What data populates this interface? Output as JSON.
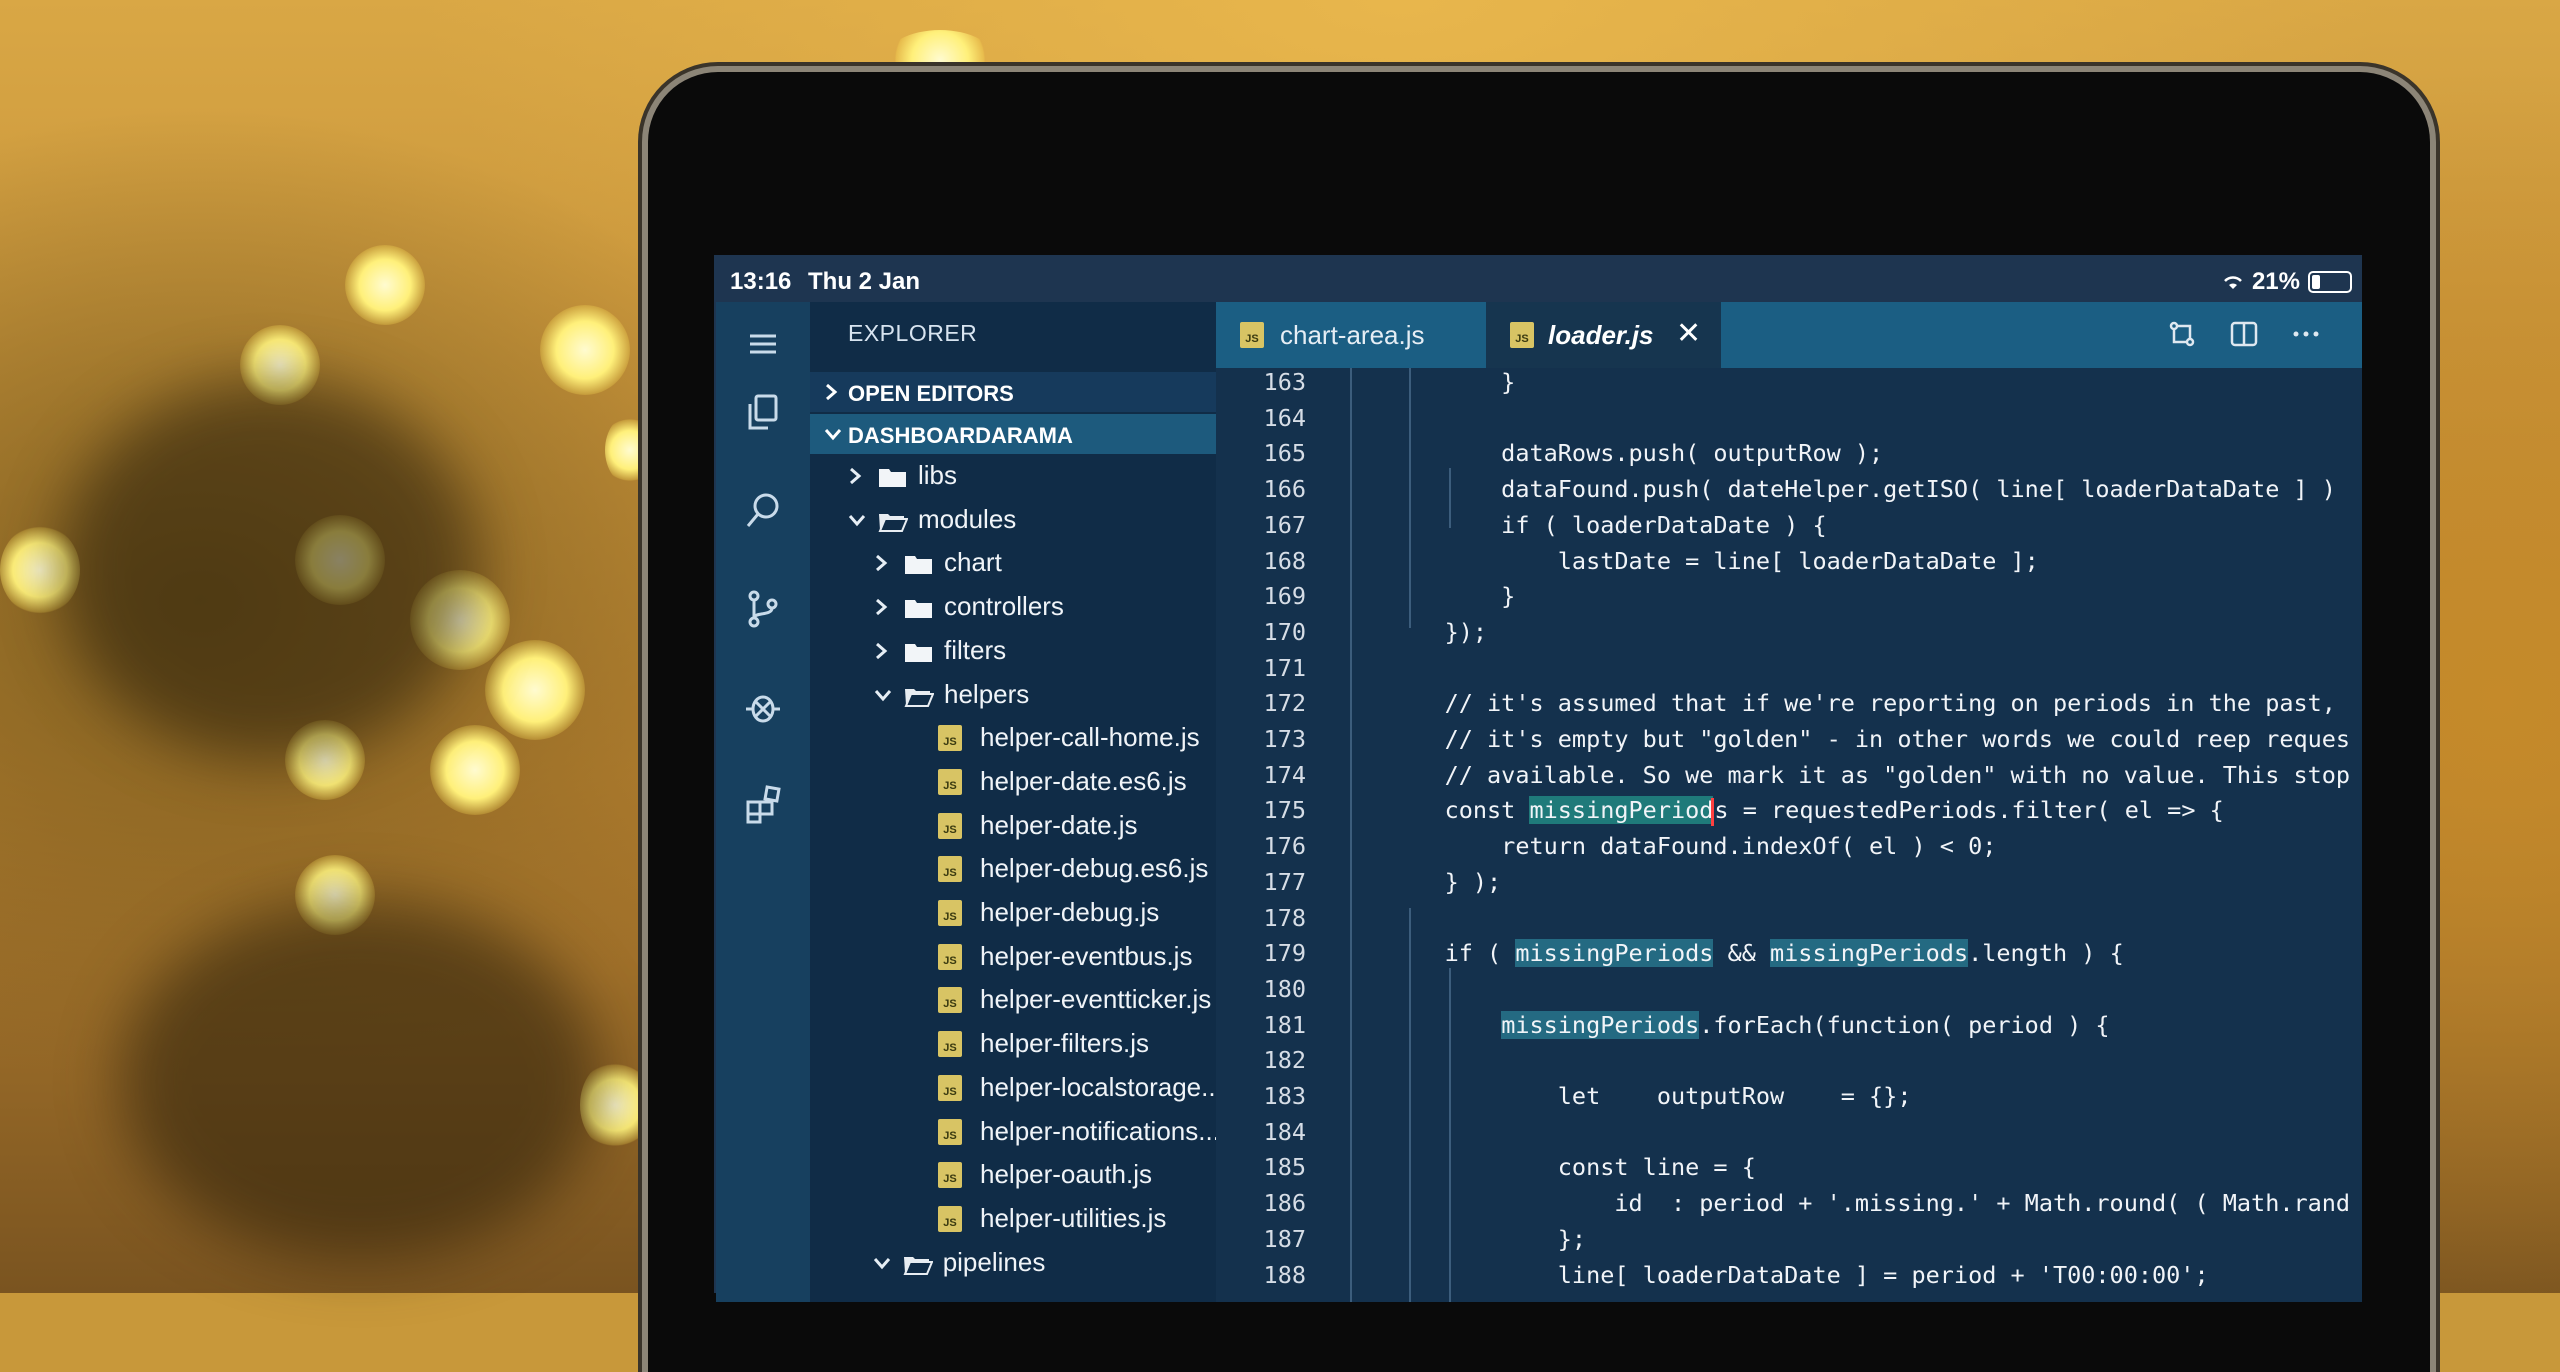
{
  "status_bar": {
    "time": "13:16",
    "date": "Thu 2 Jan",
    "battery": "21%"
  },
  "explorer": {
    "title": "EXPLORER",
    "open_editors": "OPEN EDITORS",
    "project": "DASHBOARDARAMA",
    "items": [
      {
        "name": "libs",
        "kind": "folder",
        "state": "collapsed"
      },
      {
        "name": "modules",
        "kind": "folder",
        "state": "expanded"
      },
      {
        "name": "chart",
        "kind": "folder",
        "state": "collapsed"
      },
      {
        "name": "controllers",
        "kind": "folder",
        "state": "collapsed"
      },
      {
        "name": "filters",
        "kind": "folder",
        "state": "collapsed"
      },
      {
        "name": "helpers",
        "kind": "folder",
        "state": "expanded"
      },
      {
        "name": "helper-call-home.js",
        "kind": "file"
      },
      {
        "name": "helper-date.es6.js",
        "kind": "file"
      },
      {
        "name": "helper-date.js",
        "kind": "file"
      },
      {
        "name": "helper-debug.es6.js",
        "kind": "file"
      },
      {
        "name": "helper-debug.js",
        "kind": "file"
      },
      {
        "name": "helper-eventbus.js",
        "kind": "file"
      },
      {
        "name": "helper-eventticker.js",
        "kind": "file"
      },
      {
        "name": "helper-filters.js",
        "kind": "file"
      },
      {
        "name": "helper-localstorage...",
        "kind": "file"
      },
      {
        "name": "helper-notifications...",
        "kind": "file"
      },
      {
        "name": "helper-oauth.js",
        "kind": "file"
      },
      {
        "name": "helper-utilities.js",
        "kind": "file"
      },
      {
        "name": "pipelines",
        "kind": "folder",
        "state": "expanded"
      }
    ]
  },
  "tabs": [
    {
      "label": "chart-area.js",
      "active": false
    },
    {
      "label": "loader.js",
      "active": true
    }
  ],
  "tab_close": "✕",
  "code_lines": [
    {
      "n": "163",
      "text": "        }"
    },
    {
      "n": "164",
      "text": ""
    },
    {
      "n": "165",
      "text": "        dataRows.push( outputRow );"
    },
    {
      "n": "166",
      "text": "        dataFound.push( dateHelper.getISO( line[ loaderDataDate ] )"
    },
    {
      "n": "167",
      "text": "        if ( loaderDataDate ) {"
    },
    {
      "n": "168",
      "text": "            lastDate = line[ loaderDataDate ];"
    },
    {
      "n": "169",
      "text": "        }"
    },
    {
      "n": "170",
      "text": "    });"
    },
    {
      "n": "171",
      "text": ""
    },
    {
      "n": "172",
      "text": "    // it's assumed that if we're reporting on periods in the past,"
    },
    {
      "n": "173",
      "text": "    // it's empty but \"golden\" - in other words we could reep reques"
    },
    {
      "n": "174",
      "text": "    // available. So we mark it as \"golden\" with no value. This stop"
    },
    {
      "n": "175",
      "text": "    const missingPeriods = requestedPeriods.filter( el => {"
    },
    {
      "n": "176",
      "text": "        return dataFound.indexOf( el ) < 0;"
    },
    {
      "n": "177",
      "text": "    } );"
    },
    {
      "n": "178",
      "text": ""
    },
    {
      "n": "179",
      "text": "    if ( missingPeriods && missingPeriods.length ) {"
    },
    {
      "n": "180",
      "text": ""
    },
    {
      "n": "181",
      "text": "        missingPeriods.forEach(function( period ) {"
    },
    {
      "n": "182",
      "text": ""
    },
    {
      "n": "183",
      "text": "            let    outputRow    = {};"
    },
    {
      "n": "184",
      "text": ""
    },
    {
      "n": "185",
      "text": "            const line = {"
    },
    {
      "n": "186",
      "text": "                id  : period + '.missing.' + Math.round( ( Math.rand"
    },
    {
      "n": "187",
      "text": "            };"
    },
    {
      "n": "188",
      "text": "            line[ loaderDataDate ] = period + 'T00:00:00';"
    }
  ],
  "colors": {
    "activity_bar": "#17405f",
    "sidebar": "#102c47",
    "tab_bar": "#1b5e83",
    "editor_bg": "#14314d",
    "highlight": "#1f7a7a",
    "js_icon": "#d8c464"
  },
  "activity_icons": [
    "menu-icon",
    "files-icon",
    "search-icon",
    "source-control-icon",
    "debug-icon",
    "extensions-icon"
  ]
}
